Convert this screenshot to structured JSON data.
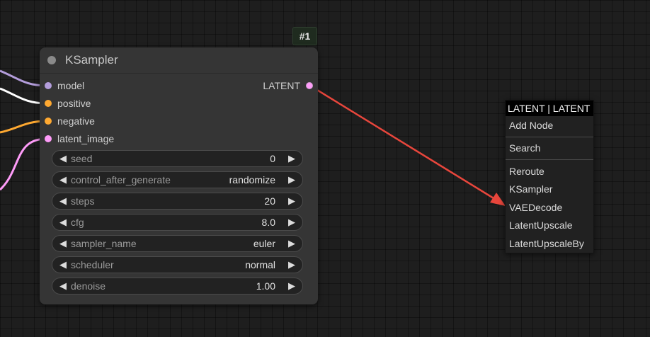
{
  "node": {
    "id_badge": "#1",
    "title": "KSampler",
    "inputs": [
      {
        "label": "model",
        "color": "#b39ddb"
      },
      {
        "label": "positive",
        "color": "#ffa931"
      },
      {
        "label": "negative",
        "color": "#ffa931"
      },
      {
        "label": "latent_image",
        "color": "#ff9cf9"
      }
    ],
    "output": {
      "label": "LATENT",
      "color": "#ff9cf9"
    },
    "widgets": [
      {
        "label": "seed",
        "value": "0"
      },
      {
        "label": "control_after_generate",
        "value": "randomize"
      },
      {
        "label": "steps",
        "value": "20"
      },
      {
        "label": "cfg",
        "value": "8.0"
      },
      {
        "label": "sampler_name",
        "value": "euler"
      },
      {
        "label": "scheduler",
        "value": "normal"
      },
      {
        "label": "denoise",
        "value": "1.00"
      }
    ]
  },
  "context_menu": {
    "title": "LATENT | LATENT",
    "items": [
      "Add Node",
      "Search",
      "Reroute",
      "KSampler",
      "VAEDecode",
      "LatentUpscale",
      "LatentUpscaleBy"
    ]
  },
  "colors": {
    "drag_link": "#e8463c",
    "background": "#1e1e1e",
    "node_body": "#353535"
  },
  "icons": {
    "widget_decrement": "triangle-left-icon",
    "widget_increment": "triangle-right-icon",
    "collapse": "collapse-dot-icon"
  }
}
